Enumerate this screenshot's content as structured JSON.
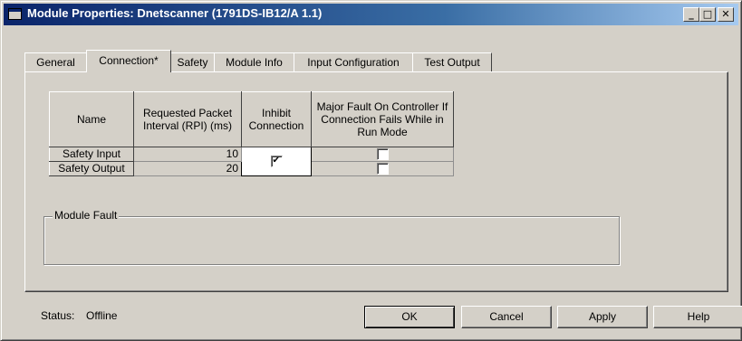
{
  "window": {
    "title": "Module Properties: Dnetscanner (1791DS-IB12/A 1.1)",
    "caption_buttons": {
      "minimize": "_",
      "maximize": "□",
      "close": "✕"
    }
  },
  "tabs": [
    {
      "label": "General",
      "active": false
    },
    {
      "label": "Connection*",
      "active": true
    },
    {
      "label": "Safety",
      "active": false
    },
    {
      "label": "Module Info",
      "active": false
    },
    {
      "label": "Input Configuration",
      "active": false
    },
    {
      "label": "Test Output",
      "active": false
    }
  ],
  "connection_table": {
    "headers": {
      "name": "Name",
      "rpi": "Requested Packet Interval (RPI) (ms)",
      "inhibit": "Inhibit Connection",
      "major_fault": "Major Fault On Controller If Connection Fails While in Run Mode"
    },
    "rows": [
      {
        "name": "Safety Input",
        "rpi": "10",
        "inhibit": true,
        "major_fault": false
      },
      {
        "name": "Safety Output",
        "rpi": "20",
        "inhibit": null,
        "major_fault": false
      }
    ]
  },
  "module_fault": {
    "label": "Module Fault",
    "text": ""
  },
  "status": {
    "label": "Status:",
    "value": "Offline"
  },
  "buttons": {
    "ok": "OK",
    "cancel": "Cancel",
    "apply": "Apply",
    "help": "Help"
  }
}
